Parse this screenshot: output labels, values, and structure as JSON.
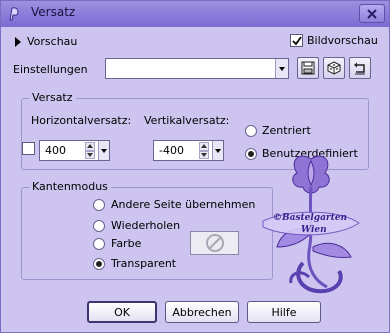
{
  "window": {
    "title": "Versatz"
  },
  "preview": {
    "label": "Vorschau",
    "image_preview_label": "Bildvorschau",
    "image_preview_checked": true
  },
  "settings": {
    "label": "Einstellungen",
    "value": ""
  },
  "offset_group": {
    "title": "Versatz",
    "horizontal_label": "Horizontalversatz:",
    "horizontal_value": "400",
    "vertical_label": "Vertikalversatz:",
    "vertical_value": "-400",
    "centered_label": "Zentriert",
    "custom_label": "Benutzerdefiniert",
    "selected": "custom"
  },
  "edge_group": {
    "title": "Kantenmodus",
    "options": [
      "Andere Seite übernehmen",
      "Wiederholen",
      "Farbe",
      "Transparent"
    ],
    "selected": "Transparent"
  },
  "watermark": {
    "line1": "©Bastelgarten",
    "line2": "Wien"
  },
  "buttons": {
    "ok": "OK",
    "cancel": "Abbrechen",
    "help": "Hilfe"
  },
  "colors": {
    "window_bg": "#cdc5ef",
    "titlebar": "#8d7ed8",
    "flower": "#7b5fc8"
  }
}
